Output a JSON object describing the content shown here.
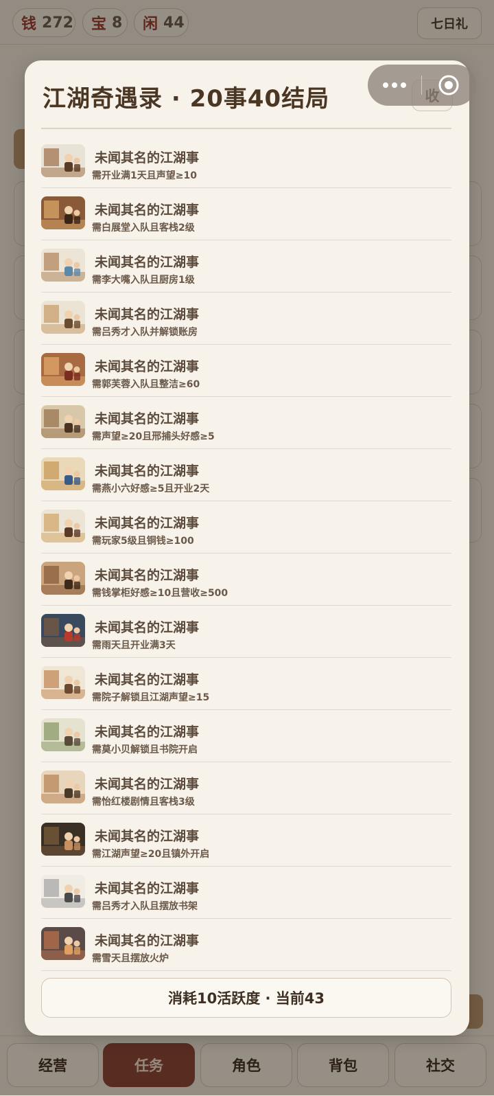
{
  "resources": [
    {
      "key": "钱",
      "value": "272"
    },
    {
      "key": "宝",
      "value": "8"
    },
    {
      "key": "闲",
      "value": "44"
    }
  ],
  "gift_label": "七日礼",
  "modal": {
    "title": "江湖奇遇录 · 20事40结局",
    "close_label": "收",
    "events": [
      {
        "name": "未闻其名的江湖事",
        "requirement": "需开业满1天且声望≥10"
      },
      {
        "name": "未闻其名的江湖事",
        "requirement": "需白展堂入队且客栈2级"
      },
      {
        "name": "未闻其名的江湖事",
        "requirement": "需李大嘴入队且厨房1级"
      },
      {
        "name": "未闻其名的江湖事",
        "requirement": "需吕秀才入队并解锁账房"
      },
      {
        "name": "未闻其名的江湖事",
        "requirement": "需郭芙蓉入队且整洁≥60"
      },
      {
        "name": "未闻其名的江湖事",
        "requirement": "需声望≥20且邢捕头好感≥5"
      },
      {
        "name": "未闻其名的江湖事",
        "requirement": "需燕小六好感≥5且开业2天"
      },
      {
        "name": "未闻其名的江湖事",
        "requirement": "需玩家5级且铜钱≥100"
      },
      {
        "name": "未闻其名的江湖事",
        "requirement": "需钱掌柜好感≥10且营收≥500"
      },
      {
        "name": "未闻其名的江湖事",
        "requirement": "需雨天且开业满3天"
      },
      {
        "name": "未闻其名的江湖事",
        "requirement": "需院子解锁且江湖声望≥15"
      },
      {
        "name": "未闻其名的江湖事",
        "requirement": "需莫小贝解锁且书院开启"
      },
      {
        "name": "未闻其名的江湖事",
        "requirement": "需怡红楼剧情且客栈3级"
      },
      {
        "name": "未闻其名的江湖事",
        "requirement": "需江湖声望≥20且镇外开启"
      },
      {
        "name": "未闻其名的江湖事",
        "requirement": "需吕秀才入队且摆放书架"
      },
      {
        "name": "未闻其名的江湖事",
        "requirement": "需雪天且摆放火炉"
      }
    ],
    "action_label": "消耗10活跃度 · 当前43"
  },
  "nav": [
    "经营",
    "任务",
    "角色",
    "背包",
    "社交"
  ],
  "nav_active": "任务",
  "thumb_palettes": [
    [
      "#e9e2d6",
      "#a07650",
      "#5a3b25"
    ],
    [
      "#8a5a38",
      "#d9a668",
      "#3a2418"
    ],
    [
      "#ece4d5",
      "#b48a60",
      "#5e88a8"
    ],
    [
      "#ebe3d3",
      "#c9a070",
      "#6a4a30"
    ],
    [
      "#a86a40",
      "#e0a86a",
      "#7a2d20"
    ],
    [
      "#d8c7a8",
      "#9a7650",
      "#4a3222"
    ],
    [
      "#ead9b8",
      "#c89a5a",
      "#3a5a88"
    ],
    [
      "#ece4d5",
      "#d4a86c",
      "#5a3a28"
    ],
    [
      "#c9a47c",
      "#8a5e3c",
      "#3e2a1c"
    ],
    [
      "#3a4a5e",
      "#7a5a40",
      "#b83a2a"
    ],
    [
      "#efe6d6",
      "#c48a58",
      "#6a4a30"
    ],
    [
      "#e6e2d0",
      "#8a9a6a",
      "#5a4a3a"
    ],
    [
      "#e8d6bc",
      "#b8865a",
      "#4a3a2a"
    ],
    [
      "#3a3026",
      "#7a5a3a",
      "#c89060"
    ],
    [
      "#f0ebe3",
      "#a8a8a8",
      "#4a4a4a"
    ],
    [
      "#5a4a48",
      "#b8704a",
      "#e0a060"
    ]
  ]
}
